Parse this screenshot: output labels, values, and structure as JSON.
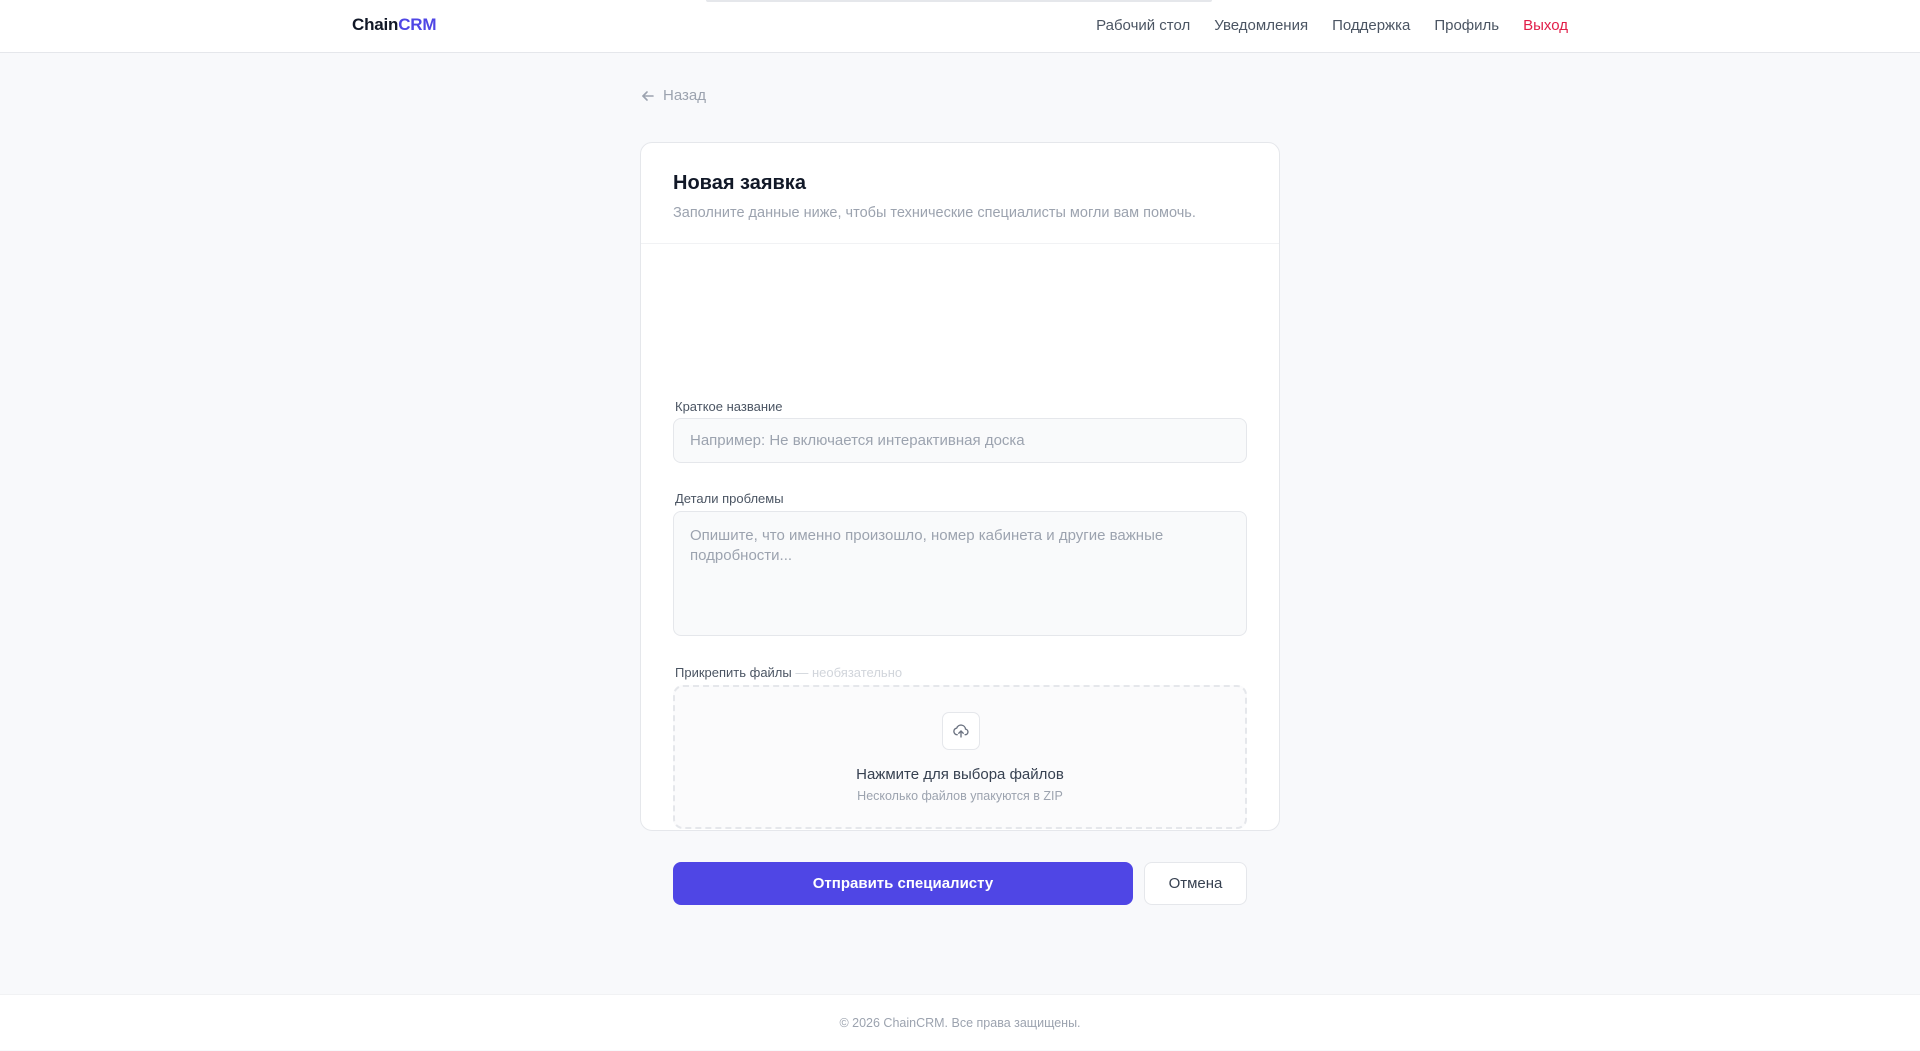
{
  "brand": {
    "name_main": "Chain",
    "name_accent": "CRM",
    "accent_color": "#4f46e5"
  },
  "nav": {
    "items": [
      {
        "label": "Рабочий стол"
      },
      {
        "label": "Уведомления"
      },
      {
        "label": "Поддержка"
      },
      {
        "label": "Профиль"
      }
    ],
    "logout_label": "Выход",
    "logout_color": "#e11d48"
  },
  "back": {
    "label": "Назад",
    "icon": "arrow-left-icon"
  },
  "form": {
    "title": "Новая заявка",
    "subtitle": "Заполните данные ниже, чтобы технические специалисты могли вам помочь.",
    "short_title": {
      "label": "Краткое название",
      "placeholder": "Например: Не включается интерактивная доска",
      "value": ""
    },
    "details": {
      "label": "Детали проблемы",
      "placeholder": "Опишите, что именно произошло, номер кабинета и другие важные подробности...",
      "value": ""
    },
    "attachments": {
      "label": "Прикрепить файлы",
      "optional_note": "— необязательно",
      "icon": "upload-cloud-icon",
      "drop_title": "Нажмите для выбора файлов",
      "drop_hint": "Несколько файлов упакуются в ZIP"
    },
    "submit_label": "Отправить специалисту",
    "cancel_label": "Отмена"
  },
  "footer": {
    "text": "© 2026 ChainCRM. Все права защищены."
  }
}
